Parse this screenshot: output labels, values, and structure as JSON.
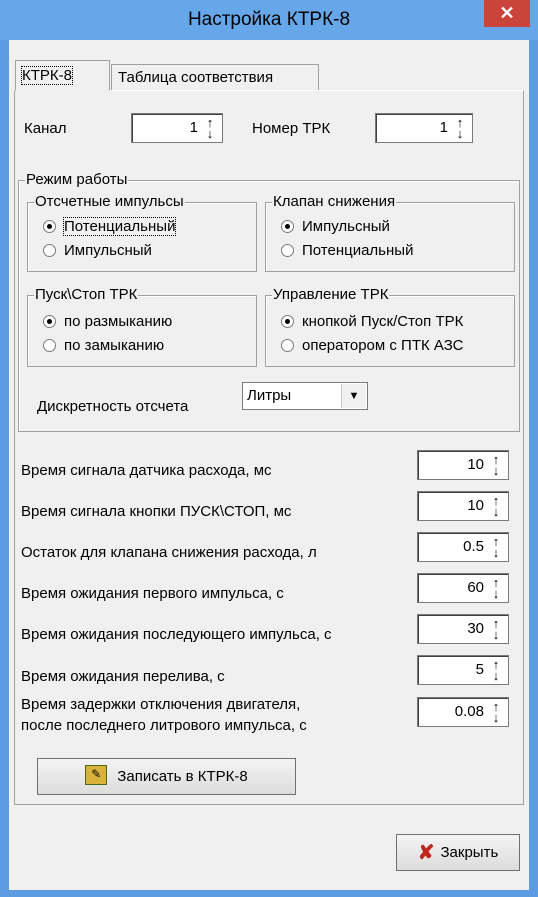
{
  "window": {
    "title": "Настройка КТРК-8",
    "close_icon": "close-icon"
  },
  "tabs": [
    {
      "label": "КТРК-8",
      "active": true
    },
    {
      "label": "Таблица соответствия",
      "active": false
    }
  ],
  "channel": {
    "label": "Канал",
    "value": "1"
  },
  "trk_number": {
    "label": "Номер ТРК",
    "value": "1"
  },
  "mode_group": {
    "title": "Режим работы"
  },
  "pulses_group": {
    "title": "Отсчетные импульсы",
    "options": [
      {
        "label": "Потенциальный",
        "checked": true
      },
      {
        "label": "Импульсный",
        "checked": false
      }
    ]
  },
  "valve_group": {
    "title": "Клапан снижения",
    "options": [
      {
        "label": "Импульсный",
        "checked": true
      },
      {
        "label": "Потенциальный",
        "checked": false
      }
    ]
  },
  "startstop_group": {
    "title": "Пуск\\Стоп ТРК",
    "options": [
      {
        "label": "по размыканию",
        "checked": true
      },
      {
        "label": "по замыканию",
        "checked": false
      }
    ]
  },
  "control_group": {
    "title": "Управление ТРК",
    "options": [
      {
        "label": "кнопкой Пуск/Стоп ТРК",
        "checked": true
      },
      {
        "label": "оператором с ПТК АЗС",
        "checked": false
      }
    ]
  },
  "discreteness": {
    "label": "Дискретность отсчета",
    "value": "Литры"
  },
  "params": [
    {
      "label": "Время сигнала датчика расхода, мс",
      "value": "10"
    },
    {
      "label": "Время сигнала кнопки ПУСК\\СТОП, мс",
      "value": "10"
    },
    {
      "label": "Остаток для клапана снижения расхода, л",
      "value": "0.5"
    },
    {
      "label": "Время ожидания первого импульса, с",
      "value": "60"
    },
    {
      "label": "Время ожидания последующего импульса, с",
      "value": "30"
    },
    {
      "label": "Время ожидания перелива, с",
      "value": "5"
    },
    {
      "label_line1": "Время задержки отключения двигателя,",
      "label_line2": "после последнего литрового импульса, с",
      "value": "0.08"
    }
  ],
  "write_button": {
    "label": "Записать в КТРК-8",
    "icon": "write-icon"
  },
  "close_button": {
    "label": "Закрыть",
    "icon": "red-x-icon",
    "icon_color": "#c0281e"
  }
}
